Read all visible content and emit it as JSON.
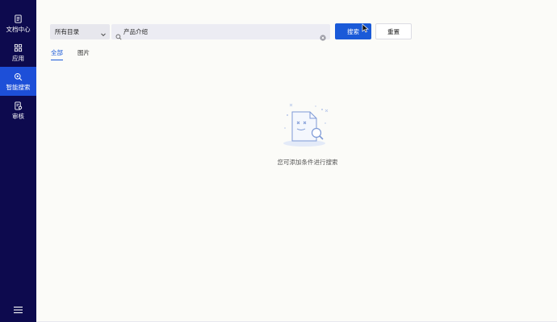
{
  "sidebar": {
    "items": [
      {
        "label": "文档中心",
        "icon": "document-icon"
      },
      {
        "label": "应用",
        "icon": "apps-grid-icon"
      },
      {
        "label": "智能搜索",
        "icon": "smart-search-icon",
        "active": true
      },
      {
        "label": "审核",
        "icon": "review-icon"
      }
    ],
    "menu_icon": "hamburger-menu-icon"
  },
  "search": {
    "directory_selected": "所有目录",
    "query": "产品介绍",
    "search_label": "搜索",
    "reset_label": "重置"
  },
  "tabs": [
    {
      "label": "全部",
      "active": true
    },
    {
      "label": "图片",
      "active": false
    }
  ],
  "empty_state": {
    "message": "您可添加条件进行搜索"
  },
  "colors": {
    "sidebar_bg": "#0d0a4e",
    "sidebar_active": "#1d4fd8",
    "accent": "#1a5ad8",
    "page_bg": "#fbfbf8"
  }
}
